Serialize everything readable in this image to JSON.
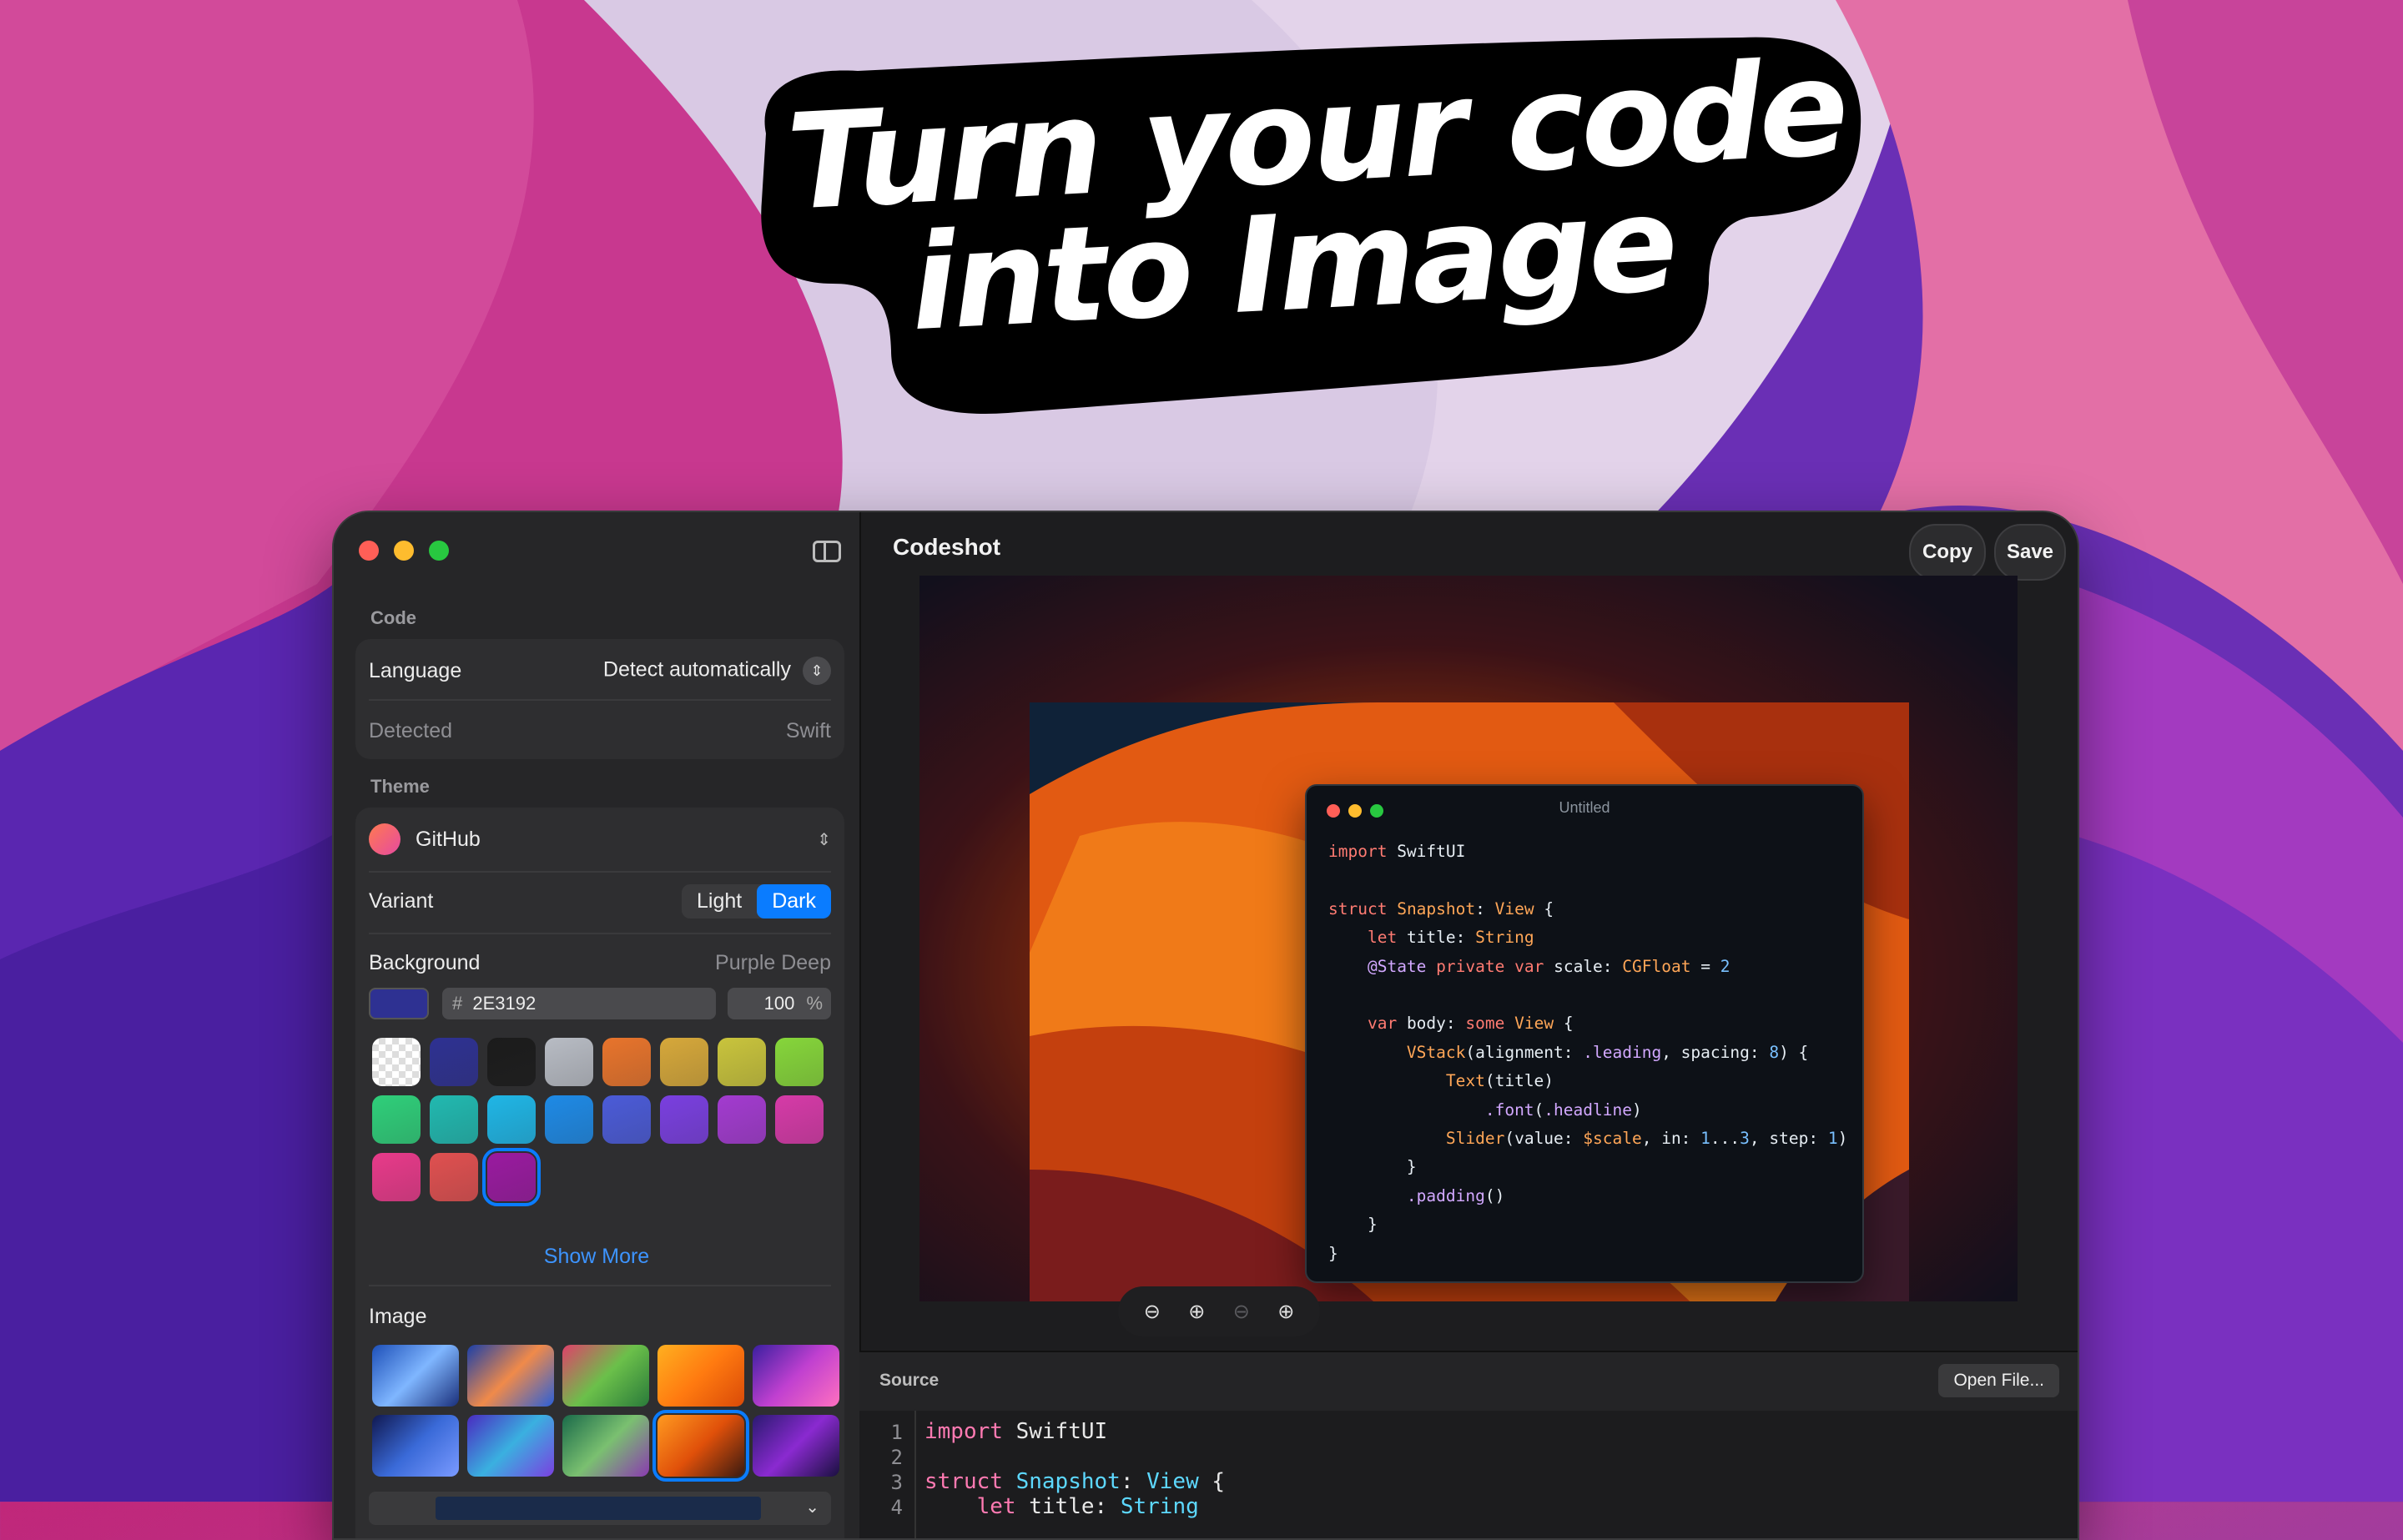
{
  "headline": {
    "line1": "Turn your code",
    "line2": "into Image"
  },
  "window": {
    "title": "Codeshot",
    "copy_label": "Copy",
    "save_label": "Save"
  },
  "sidebar": {
    "code_section": "Code",
    "language_label": "Language",
    "language_value": "Detect automatically",
    "detected_label": "Detected",
    "detected_value": "Swift",
    "theme_section": "Theme",
    "theme_value": "GitHub",
    "variant_label": "Variant",
    "variant_options": [
      "Light",
      "Dark"
    ],
    "variant_selected": "Dark",
    "background_label": "Background",
    "background_value": "Purple Deep",
    "hex_prefix": "#",
    "hex_value": "2E3192",
    "opacity_value": "100",
    "opacity_unit": "%",
    "swatch_colors": [
      "checker",
      "#2e3192",
      "#1b1b1b",
      "#b8bcc4",
      "#e8742c",
      "#d6a83a",
      "#c9c43c",
      "#86d63a",
      "#2fcf7a",
      "#21b9b0",
      "#1fb6e6",
      "#1e8ae6",
      "#4b5bd8",
      "#7a3fe0",
      "#a33bd0",
      "#d63aa8",
      "#e83a8a",
      "#e05050",
      "#9a1aa0"
    ],
    "swatch_selected_index": 18,
    "show_more_label": "Show More",
    "image_section": "Image",
    "image_selected_index": 8
  },
  "preview": {
    "card_title": "Untitled",
    "zoom_icons": [
      "zoom-out-icon",
      "zoom-fit-icon",
      "zoom-actual-icon",
      "zoom-in-icon"
    ]
  },
  "source": {
    "label": "Source",
    "open_file_label": "Open File...",
    "line_numbers": [
      "1",
      "2",
      "3",
      "4"
    ]
  }
}
